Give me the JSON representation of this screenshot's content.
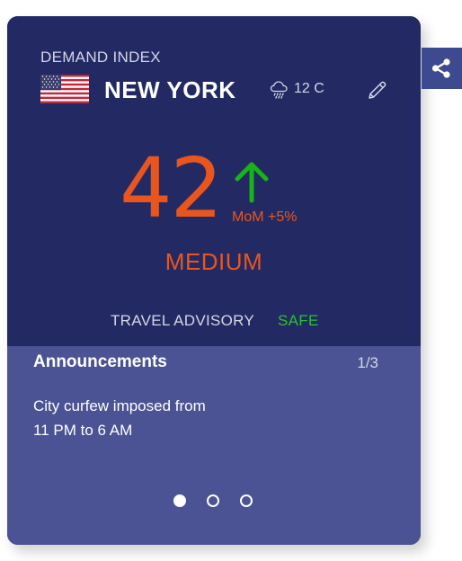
{
  "card": {
    "section_label": "DEMAND INDEX",
    "city": "NEW YORK",
    "flag": "us-flag",
    "weather": {
      "icon": "rain-cloud-icon",
      "temperature": "12 C"
    },
    "index_value": "42",
    "trend": {
      "direction": "up",
      "label": "MoM +5%"
    },
    "level": "MEDIUM",
    "advisory": {
      "label": "TRAVEL ADVISORY",
      "value": "SAFE"
    },
    "announcements": {
      "title": "Announcements",
      "page": "1/3",
      "text_line1": "City curfew imposed from",
      "text_line2": "11 PM to 6 AM",
      "current_index": 0,
      "total": 3
    }
  },
  "colors": {
    "card_top": "#232a63",
    "card_bottom": "#4b5394",
    "accent_orange": "#e8561e",
    "safe_green": "#2bbf35",
    "trend_green": "#17b317",
    "share_button": "#3d4a8f"
  },
  "share": {
    "icon": "share-icon"
  }
}
